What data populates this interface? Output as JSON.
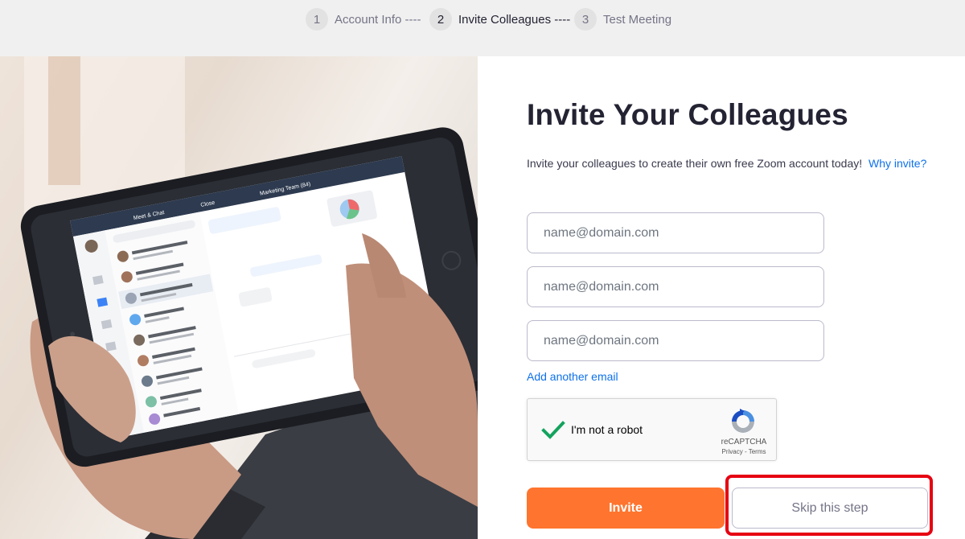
{
  "stepper": {
    "steps": [
      {
        "num": "1",
        "label": "Account Info ----"
      },
      {
        "num": "2",
        "label": "Invite Colleagues ----"
      },
      {
        "num": "3",
        "label": "Test Meeting"
      }
    ],
    "active_step": "2"
  },
  "hero": {
    "image": "hands holding tablet showing chat app",
    "tablet_header_left": "Meet & Chat",
    "tablet_header_mid": "Close",
    "tablet_header_right": "Marketing Team (84)"
  },
  "main": {
    "title": "Invite Your Colleagues",
    "subtitle": "Invite your colleagues to create their own free Zoom account today!",
    "why_invite_link": "Why invite?",
    "email_fields": [
      {
        "placeholder": "name@domain.com",
        "value": ""
      },
      {
        "placeholder": "name@domain.com",
        "value": ""
      },
      {
        "placeholder": "name@domain.com",
        "value": ""
      }
    ],
    "add_another_email": "Add another email",
    "recaptcha": {
      "label": "I'm not a robot",
      "brand": "reCAPTCHA",
      "links": "Privacy - Terms",
      "checked": true
    },
    "invite_button": "Invite",
    "skip_button": "Skip this step"
  },
  "colors": {
    "accent_orange": "#ff742e",
    "link_blue": "#0e71eb",
    "highlight_red": "#e60012",
    "stepper_bg": "#f0f0f0"
  }
}
